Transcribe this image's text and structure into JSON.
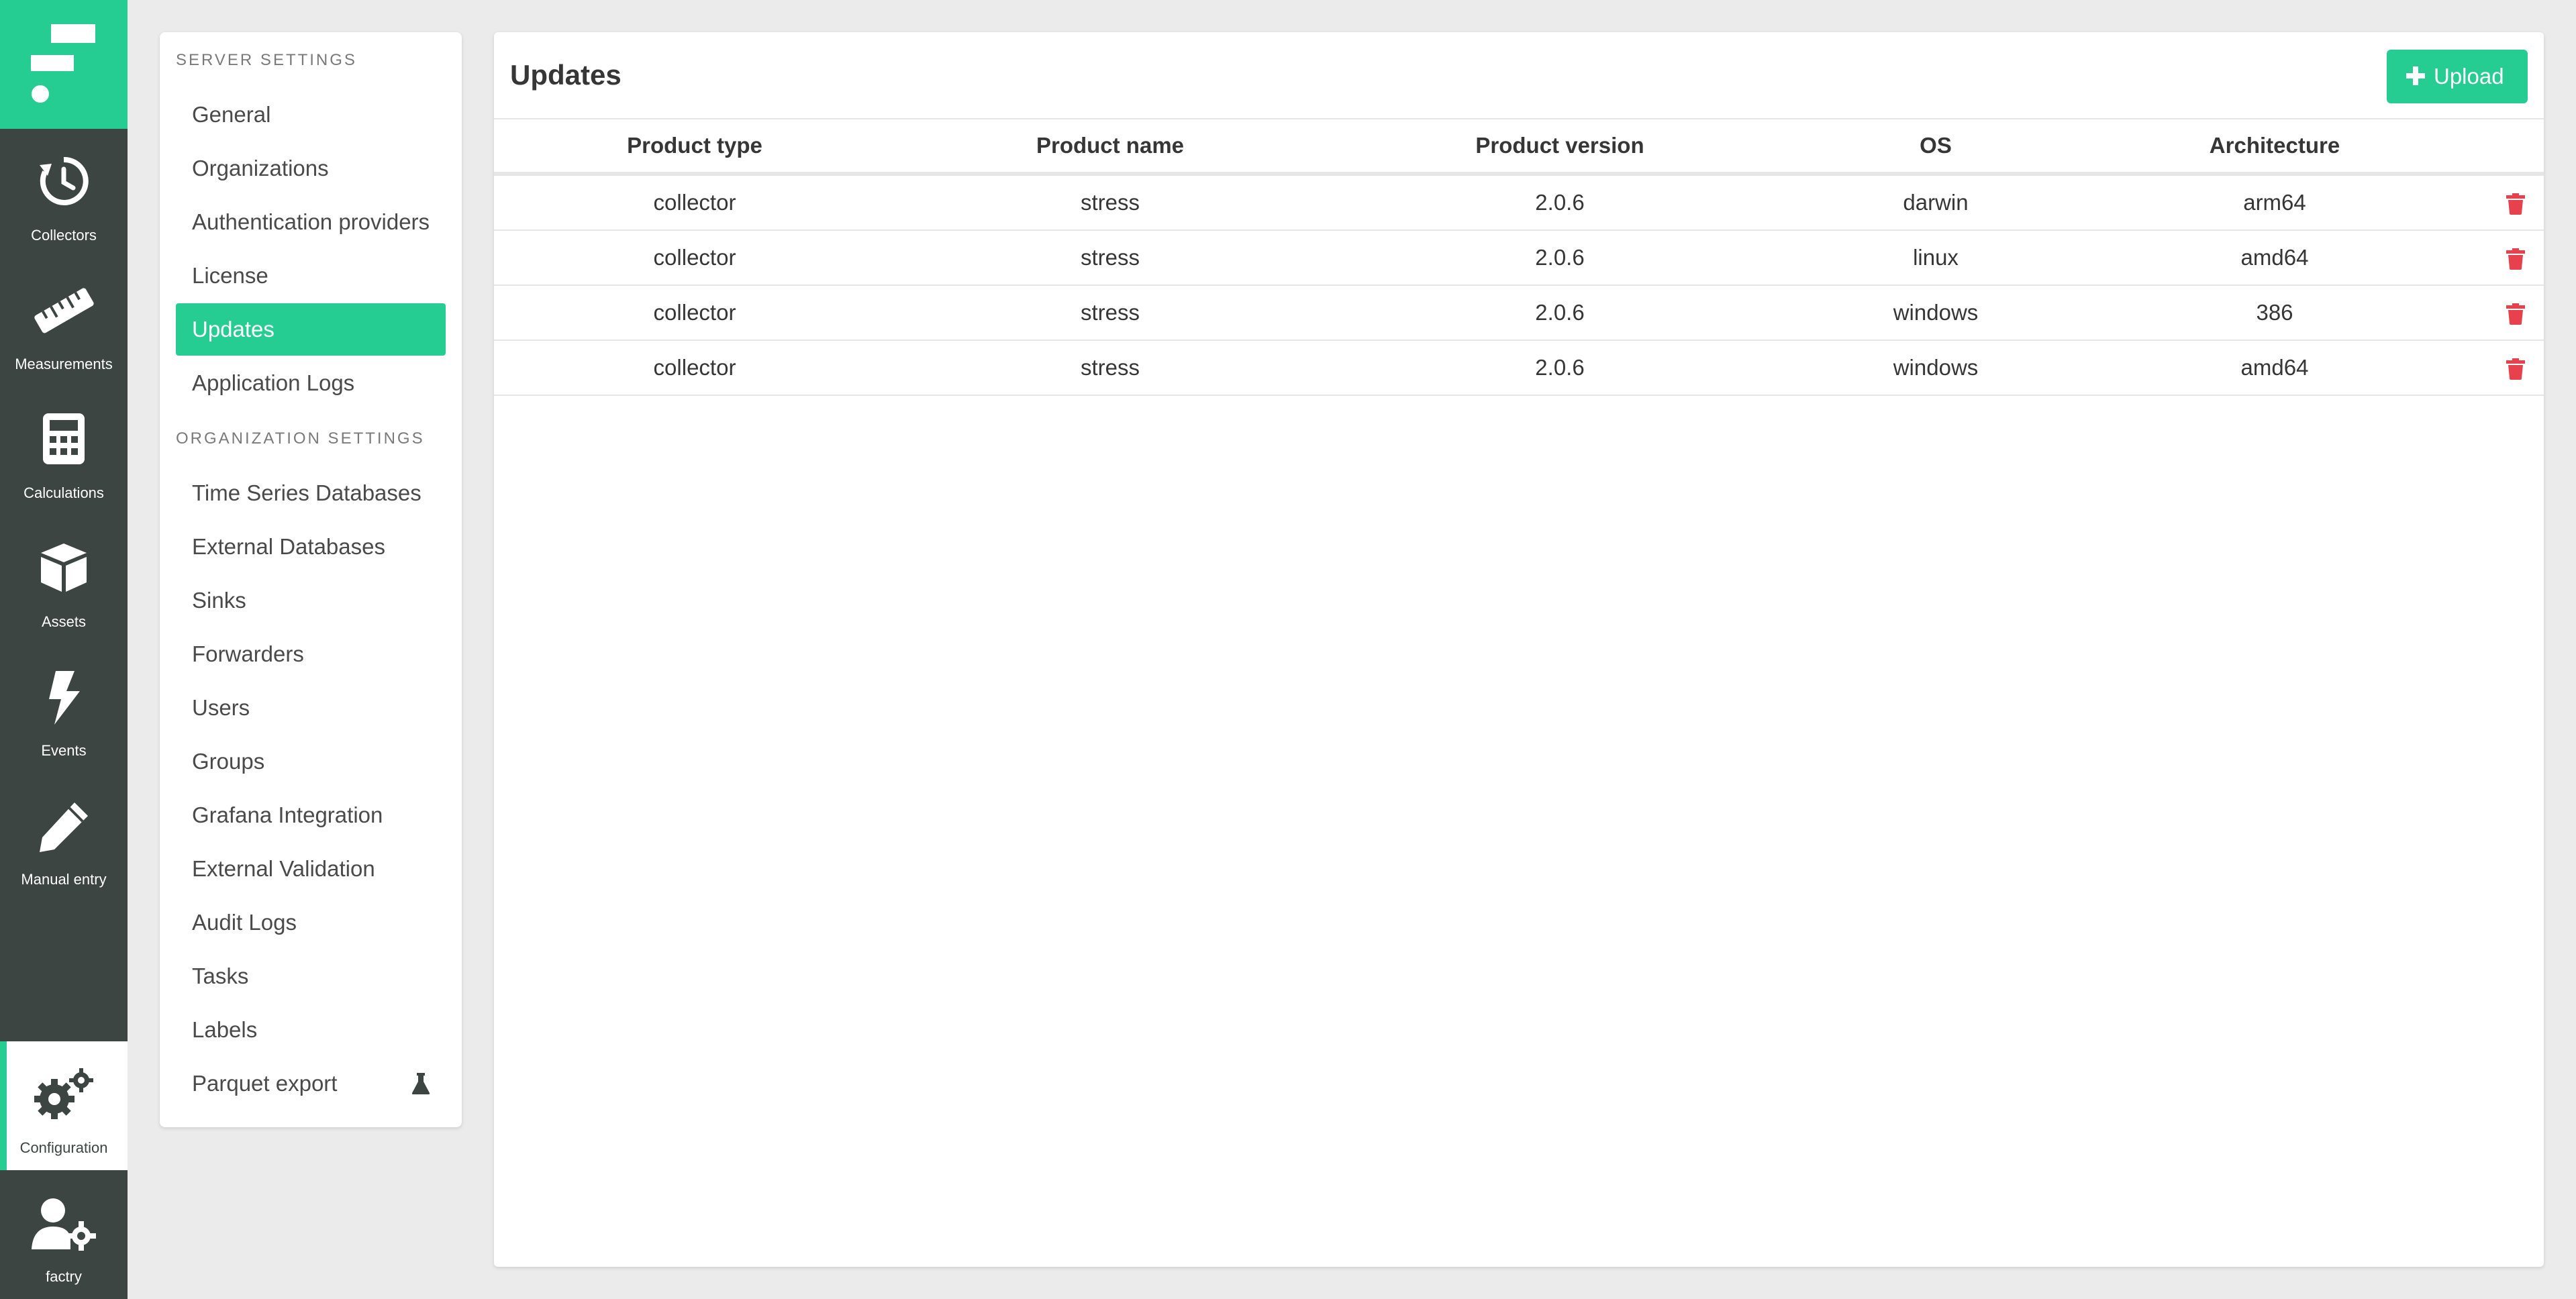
{
  "nav": {
    "items": [
      {
        "label": "Collectors",
        "icon": "history-icon"
      },
      {
        "label": "Measurements",
        "icon": "ruler-icon"
      },
      {
        "label": "Calculations",
        "icon": "calculator-icon"
      },
      {
        "label": "Assets",
        "icon": "cube-icon"
      },
      {
        "label": "Events",
        "icon": "bolt-icon"
      },
      {
        "label": "Manual entry",
        "icon": "pen-icon"
      }
    ],
    "configuration": {
      "label": "Configuration",
      "icon": "gears-icon"
    },
    "user": {
      "label": "factry",
      "icon": "user-gear-icon"
    }
  },
  "menu": {
    "server_section": "SERVER SETTINGS",
    "server_items": [
      "General",
      "Organizations",
      "Authentication providers",
      "License",
      "Updates",
      "Application Logs"
    ],
    "org_section": "ORGANIZATION SETTINGS",
    "org_items": [
      "Time Series Databases",
      "External Databases",
      "Sinks",
      "Forwarders",
      "Users",
      "Groups",
      "Grafana Integration",
      "External Validation",
      "Audit Logs",
      "Tasks",
      "Labels",
      "Parquet export"
    ],
    "active": "Updates"
  },
  "main": {
    "title": "Updates",
    "upload_label": "Upload",
    "columns": [
      "Product type",
      "Product name",
      "Product version",
      "OS",
      "Architecture"
    ],
    "rows": [
      [
        "collector",
        "stress",
        "2.0.6",
        "darwin",
        "arm64"
      ],
      [
        "collector",
        "stress",
        "2.0.6",
        "linux",
        "amd64"
      ],
      [
        "collector",
        "stress",
        "2.0.6",
        "windows",
        "386"
      ],
      [
        "collector",
        "stress",
        "2.0.6",
        "windows",
        "amd64"
      ]
    ]
  },
  "colors": {
    "accent": "#26cd92",
    "rail": "#3d4543",
    "danger": "#e8414e"
  }
}
